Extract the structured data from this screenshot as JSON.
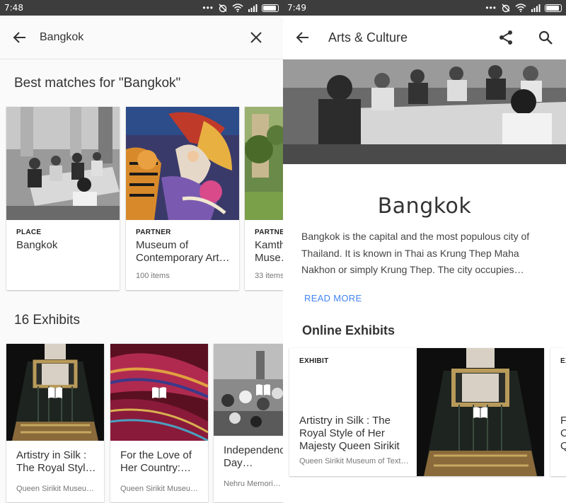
{
  "left": {
    "status": {
      "time": "7:48"
    },
    "search": {
      "query": "Bangkok"
    },
    "best_matches": {
      "heading": "Best matches for \"Bangkok\"",
      "cards": [
        {
          "type": "PLACE",
          "title": "Bangkok",
          "subtitle": ""
        },
        {
          "type": "PARTNER",
          "title": "Museum of Contemporary Art…",
          "subtitle": "100 items"
        },
        {
          "type": "PARTNER",
          "title": "Kamth… Muse…",
          "subtitle": "33 items"
        }
      ]
    },
    "exhibits": {
      "heading": "16 Exhibits",
      "cards": [
        {
          "title": "Artistry in Silk : The Royal Styl…",
          "subtitle": "Queen Sirikit Museu…"
        },
        {
          "title": "For the Love of Her Country:…",
          "subtitle": "Queen Sirikit Museu…"
        },
        {
          "title": "Independenc Day…",
          "subtitle": "Nehru Memorial…"
        }
      ]
    }
  },
  "right": {
    "status": {
      "time": "7:49"
    },
    "app_bar": {
      "title": "Arts & Culture"
    },
    "place": {
      "title": "Bangkok",
      "description": "Bangkok is the capital and the most populous city of Thailand. It is known in Thai as Krung Thep Maha Nakhon or simply Krung Thep. The city occupies…",
      "read_more": "READ MORE"
    },
    "online_exhibits": {
      "heading": "Online Exhibits",
      "card": {
        "type": "EXHIBIT",
        "title": "Artistry in Silk : The Royal Style of Her Majesty Queen Sirikit",
        "subtitle": "Queen Sirikit Museum of Text…"
      },
      "peek": {
        "type": "EX",
        "title": "F C Q"
      }
    }
  },
  "icons": {
    "back": "arrow-left-icon",
    "close": "close-icon",
    "share": "share-icon",
    "search": "search-icon",
    "exhibit_badge": "book-icon"
  },
  "colors": {
    "accent": "#4285f4",
    "status_bar": "#3d3d3d"
  }
}
